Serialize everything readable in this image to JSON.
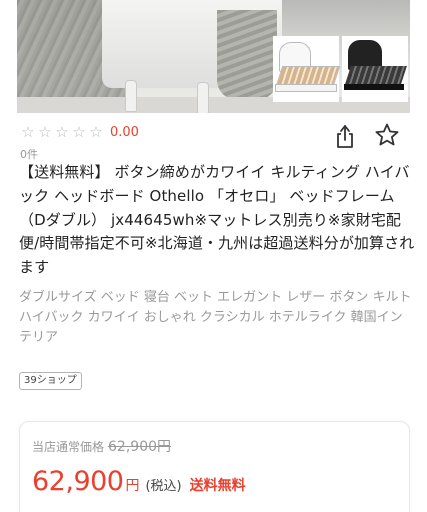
{
  "product_image": {
    "alt": "",
    "colors": [
      "#ffffff",
      "#000000"
    ]
  },
  "rating": {
    "stars_filled": 0,
    "stars_total": 5,
    "score": "0.00",
    "review_count": "0件"
  },
  "actions": {
    "share_icon": "share-icon",
    "favorite_icon": "star-outline-icon"
  },
  "product": {
    "title": "【送料無料】 ボタン締めがカワイイ キルティング ハイバック ヘッドボード Othello 「オセロ」 ベッドフレーム （Dダブル） jx44645wh※マットレス別売り※家財宅配便/時間帯指定不可※北海道・九州は超過送料分が加算されます",
    "tags": "ダブルサイズ ベッド 寝台 ベット エレガント レザー ボタン キルト ハイバック カワイイ おしゃれ クラシカル ホテルライク 韓国インテリア",
    "shop_badge": "39ショップ"
  },
  "price": {
    "regular_label": "当店通常価格",
    "regular_value": "62,900円",
    "current_value": "62,900",
    "currency": "円",
    "tax_label": "(税込)",
    "shipping_label": "送料無料",
    "accent_color": "#e8412f"
  }
}
